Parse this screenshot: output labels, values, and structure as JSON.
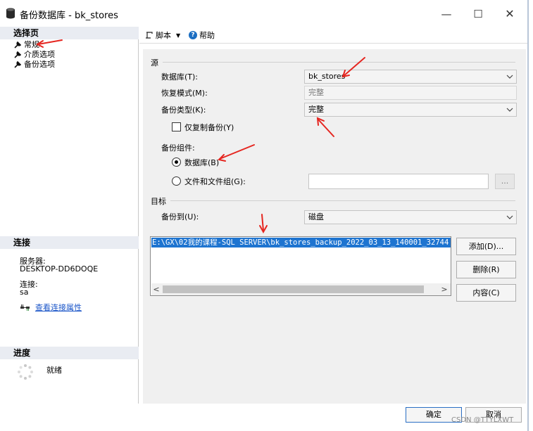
{
  "window": {
    "title": "备份数据库 - bk_stores",
    "minimize_glyph": "—",
    "maximize_glyph": "☐",
    "close_glyph": "✕"
  },
  "left": {
    "select_page_header": "选择页",
    "pages": [
      {
        "label": "常规",
        "icon": "wrench-icon",
        "selected": true
      },
      {
        "label": "介质选项",
        "icon": "wrench-icon"
      },
      {
        "label": "备份选项",
        "icon": "wrench-icon"
      }
    ],
    "connection_header": "连接",
    "server_label": "服务器:",
    "server_value": "DESKTOP-DD6DOQE",
    "connection_label": "连接:",
    "connection_value": "sa",
    "view_properties_link": "查看连接属性",
    "progress_header": "进度",
    "progress_status": "就绪"
  },
  "toolbar": {
    "script_label": "脚本",
    "script_dropdown_glyph": "▼",
    "help_label": "帮助"
  },
  "source": {
    "group_title": "源",
    "database_label": "数据库(T):",
    "database_value": "bk_stores",
    "recovery_model_label": "恢复模式(M):",
    "recovery_model_value": "完整",
    "backup_type_label": "备份类型(K):",
    "backup_type_value": "完整",
    "copy_only_label": "仅复制备份(Y)",
    "copy_only_checked": false,
    "component_label": "备份组件:",
    "component_database_label": "数据库(B)",
    "component_files_label": "文件和文件组(G):",
    "selected_component": "database",
    "files_value": "",
    "browse_label": "..."
  },
  "destination": {
    "group_title": "目标",
    "backup_to_label": "备份到(U):",
    "backup_to_value": "磁盘",
    "paths": [
      "E:\\GX\\02我的课程-SQL SERVER\\bk_stores_backup_2022_03_13_140001_32744"
    ],
    "add_label": "添加(D)...",
    "remove_label": "删除(R)",
    "contents_label": "内容(C)",
    "scroll_left_glyph": "<",
    "scroll_right_glyph": ">"
  },
  "footer": {
    "ok_label": "确定",
    "cancel_label": "取消",
    "watermark": "CSDN @TTYLXWT"
  },
  "colors": {
    "selection": "#1e74d0",
    "annotation_arrow": "#e52620",
    "link": "#1a55c8"
  }
}
